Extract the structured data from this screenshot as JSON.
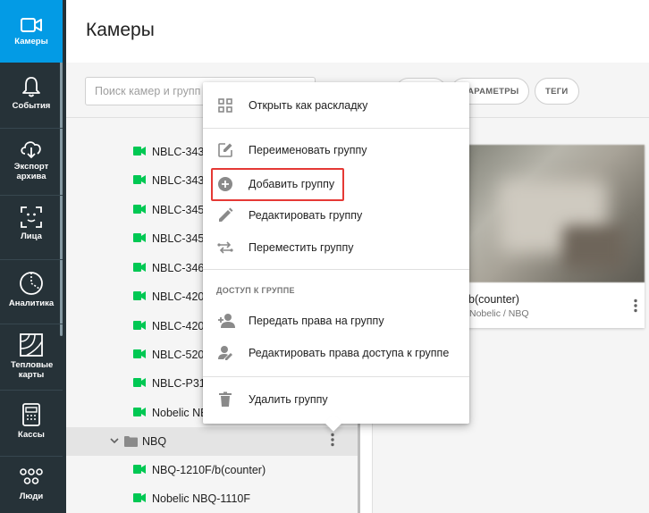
{
  "sidebar": {
    "items": [
      {
        "label": "Камеры",
        "icon": "camera-icon"
      },
      {
        "label": "События",
        "icon": "bell-icon"
      },
      {
        "label": "Экспорт архива",
        "icon": "cloud-download-icon"
      },
      {
        "label": "Лица",
        "icon": "face-scan-icon"
      },
      {
        "label": "Аналитика",
        "icon": "analytics-icon"
      },
      {
        "label": "Тепловые карты",
        "icon": "heatmap-icon"
      },
      {
        "label": "Кассы",
        "icon": "cash-register-icon"
      },
      {
        "label": "Люди",
        "icon": "people-icon"
      }
    ]
  },
  "header": {
    "title": "Камеры"
  },
  "toolbar": {
    "search_placeholder": "Поиск камер и групп",
    "chip_params": "ПАРАМЕТРЫ",
    "chip_tags": "ТЕГИ"
  },
  "tree": {
    "cameras_top": [
      "NBLC-343",
      "NBLC-343",
      "NBLC-345",
      "NBLC-345",
      "NBLC-346",
      "NBLC-420",
      "NBLC-420",
      "NBLC-520",
      "NBLC-P31",
      "Nobelic NB"
    ],
    "group": {
      "label": "NBQ"
    },
    "cameras_bottom": [
      "NBQ-1210F/b(counter)",
      "Nobelic NBQ-1110F"
    ]
  },
  "card": {
    "name": "b(counter)",
    "path": "Nobelic / NBQ"
  },
  "context_menu": {
    "items_a": [
      {
        "label": "Открыть как раскладку",
        "icon": "grid-icon"
      }
    ],
    "items_b": [
      {
        "label": "Переименовать группу",
        "icon": "edit-square-icon"
      },
      {
        "label": "Добавить группу",
        "icon": "add-circle-icon"
      },
      {
        "label": "Редактировать группу",
        "icon": "pencil-icon"
      },
      {
        "label": "Переместить группу",
        "icon": "move-arrows-icon"
      }
    ],
    "section_title": "ДОСТУП К ГРУППЕ",
    "items_c": [
      {
        "label": "Передать права на группу",
        "icon": "person-add-icon"
      },
      {
        "label": "Редактировать права доступа к группе",
        "icon": "person-edit-icon"
      }
    ],
    "items_d": [
      {
        "label": "Удалить группу",
        "icon": "trash-icon"
      }
    ]
  },
  "colors": {
    "sidebar_bg": "#263238",
    "active": "#039be5",
    "camera_green": "#00c853",
    "highlight_red": "#e53935"
  }
}
